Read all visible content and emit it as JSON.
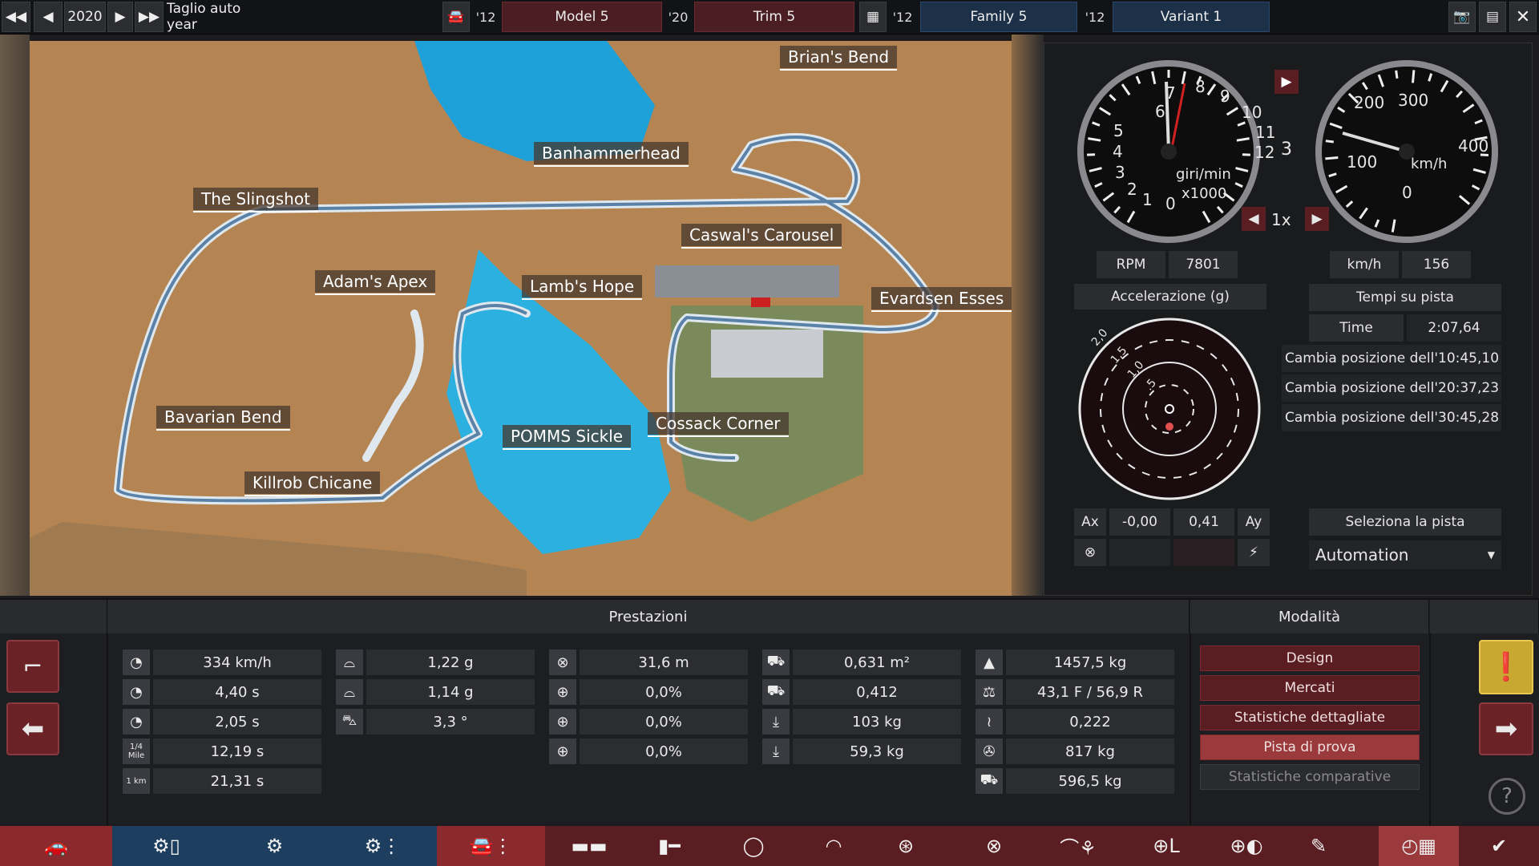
{
  "topbar": {
    "year": "2020",
    "year_label": "Taglio auto year",
    "model_year": "'12",
    "model": "Model 5",
    "trim_year": "'20",
    "trim": "Trim 5",
    "family_year": "'12",
    "family": "Family 5",
    "variant_year": "'12",
    "variant": "Variant 1"
  },
  "map": {
    "labels": [
      "Brian's Bend",
      "Banhammerhead",
      "The Slingshot",
      "Caswal's Carousel",
      "Adam's Apex",
      "Lamb's Hope",
      "Evardsen Esses",
      "Bavarian Bend",
      "POMMS Sickle",
      "Cossack Corner",
      "Killrob Chicane"
    ]
  },
  "gauges": {
    "rpm_ticks": [
      "1",
      "2",
      "3",
      "4",
      "5",
      "6",
      "7",
      "8",
      "9",
      "10",
      "11",
      "12",
      "0"
    ],
    "rpm_unit": "giri/min",
    "rpm_mult": "x1000",
    "speed_ticks": [
      "0",
      "100",
      "200",
      "300",
      "400"
    ],
    "speed_unit": "km/h",
    "gear": "3",
    "speed_mult": "1x"
  },
  "readouts": {
    "rpm_label": "RPM",
    "rpm_value": "7801",
    "kmh_label": "km/h",
    "kmh_value": "156",
    "accel_title": "Accelerazione (g)",
    "accel_rings": [
      "2,0",
      "1,5",
      "1,0",
      ".5"
    ],
    "ax_label": "Ax",
    "ax_value": "-0,00",
    "ay_value": "0,41",
    "ay_label": "Ay"
  },
  "laptimes": {
    "title": "Tempi su pista",
    "time_label": "Time",
    "time_value": "2:07,64",
    "rows": [
      "Cambia posizione dell'10:45,10",
      "Cambia posizione dell'20:37,23",
      "Cambia posizione dell'30:45,28"
    ],
    "select_track": "Seleziona la pista",
    "dropdown": "Automation"
  },
  "stats": {
    "title": "Prestazioni",
    "col1": [
      {
        "icon": "gauge-icon",
        "v": "334 km/h"
      },
      {
        "icon": "gauge-icon",
        "v": "4,40 s"
      },
      {
        "icon": "gauge-icon",
        "v": "2,05 s"
      },
      {
        "icon": "quarter-mile-icon",
        "label": "1/4 Mile",
        "v": "12,19 s"
      },
      {
        "icon": "km-icon",
        "label": "1 km",
        "v": "21,31 s"
      }
    ],
    "col2": [
      {
        "icon": "car-front-icon",
        "v": "1,22 g"
      },
      {
        "icon": "car-front-icon",
        "v": "1,14 g"
      },
      {
        "icon": "car-side-icon",
        "v": "3,3 °"
      }
    ],
    "col3": [
      {
        "icon": "brake-icon",
        "v": "31,6 m"
      },
      {
        "icon": "wheel-icon",
        "v": "0,0%"
      },
      {
        "icon": "wheel-icon",
        "v": "0,0%"
      },
      {
        "icon": "wheel-icon",
        "v": "0,0%"
      }
    ],
    "col4": [
      {
        "icon": "car-aero-icon",
        "v": "0,631 m²"
      },
      {
        "icon": "car-aero-icon",
        "v": "0,412"
      },
      {
        "icon": "downforce-icon",
        "v": "103 kg"
      },
      {
        "icon": "downforce-icon",
        "v": "59,3 kg"
      }
    ],
    "col5": [
      {
        "icon": "weight-icon",
        "v": "1457,5 kg"
      },
      {
        "icon": "balance-icon",
        "v": "43,1 F / 56,9 R"
      },
      {
        "icon": "drag-icon",
        "v": "0,222"
      },
      {
        "icon": "tools-icon",
        "v": "817 kg"
      },
      {
        "icon": "towing-icon",
        "v": "596,5 kg"
      }
    ]
  },
  "modes": {
    "title": "Modalità",
    "items": [
      "Design",
      "Mercati",
      "Statistiche dettagliate",
      "Pista di prova",
      "Statistiche comparative"
    ]
  }
}
